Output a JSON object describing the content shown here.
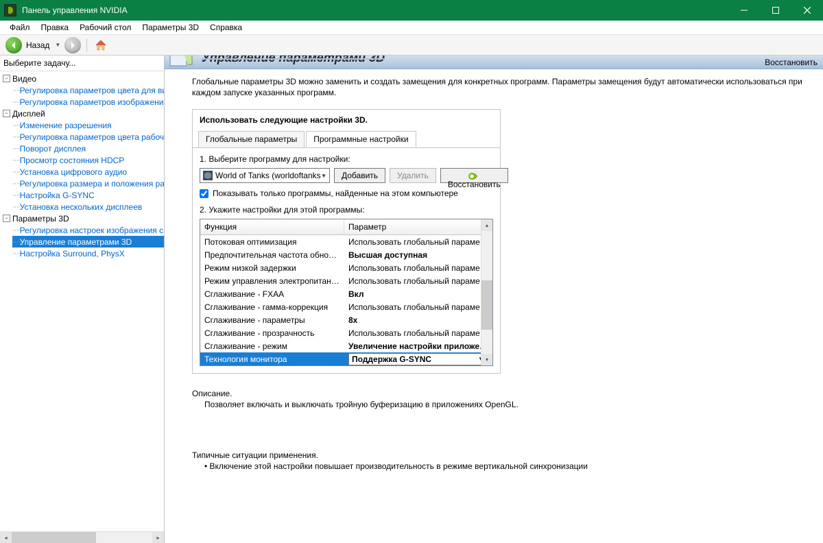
{
  "title": "Панель управления NVIDIA",
  "menu": [
    "Файл",
    "Правка",
    "Рабочий стол",
    "Параметры 3D",
    "Справка"
  ],
  "toolbar": {
    "back": "Назад"
  },
  "sidebar": {
    "header": "Выберите задачу...",
    "tree": [
      {
        "label": "Видео",
        "children": [
          "Регулировка параметров цвета для вид",
          "Регулировка параметров изображения д"
        ]
      },
      {
        "label": "Дисплей",
        "children": [
          "Изменение разрешения",
          "Регулировка параметров цвета рабочег",
          "Поворот дисплея",
          "Просмотр состояния HDCP",
          "Установка цифрового аудио",
          "Регулировка размера и положения рабо",
          "Настройка G-SYNC",
          "Установка нескольких дисплеев"
        ]
      },
      {
        "label": "Параметры 3D",
        "children": [
          "Регулировка настроек изображения с пр",
          "Управление параметрами 3D",
          "Настройка Surround, PhysX"
        ],
        "selectedIndex": 1
      }
    ]
  },
  "main": {
    "restore": "Восстановить",
    "intro": "Глобальные параметры 3D можно заменить и создать замещения для конкретных программ. Параметры замещения будут автоматически использоваться при каждом запуске указанных программ.",
    "panel_title": "Использовать следующие настройки 3D.",
    "tabs": [
      "Глобальные параметры",
      "Программные настройки"
    ],
    "active_tab": 1,
    "step1": "1. Выберите программу для настройки:",
    "program": "World of Tanks (worldoftanks.e... ",
    "btn_add": "Добавить",
    "btn_delete": "Удалить",
    "btn_restore": "Восстановить",
    "checkbox": "Показывать только программы, найденные на этом компьютере",
    "step2": "2. Укажите настройки для этой программы:",
    "grid_headers": [
      "Функция",
      "Параметр"
    ],
    "rows": [
      {
        "f": "Потоковая оптимизация",
        "p": "Использовать глобальный параметр (А..."
      },
      {
        "f": "Предпочтительная частота обновлени...",
        "p": "Высшая доступная",
        "bold": true
      },
      {
        "f": "Режим низкой задержки",
        "p": "Использовать глобальный параметр (В..."
      },
      {
        "f": "Режим управления электропитанием",
        "p": "Использовать глобальный параметр (О..."
      },
      {
        "f": "Сглаживание - FXAA",
        "p": "Вкл",
        "bold": true
      },
      {
        "f": "Сглаживание - гамма-коррекция",
        "p": "Использовать глобальный параметр (Вкл)"
      },
      {
        "f": "Сглаживание - параметры",
        "p": "8x",
        "bold": true
      },
      {
        "f": "Сглаживание - прозрачность",
        "p": "Использовать глобальный параметр (В..."
      },
      {
        "f": "Сглаживание - режим",
        "p": "Увеличение настройки приложения",
        "bold": true
      },
      {
        "f": "Технология монитора",
        "p": "Поддержка G-SYNC",
        "bold": true,
        "selected": true,
        "dropdown": true
      }
    ],
    "desc_title": "Описание.",
    "desc_text": "Позволяет включать и выключать тройную буферизацию в приложениях OpenGL.",
    "usage_title": "Типичные ситуации применения.",
    "usage_text": "• Включение этой настройки повышает производительность в режиме вертикальной синхронизации"
  }
}
